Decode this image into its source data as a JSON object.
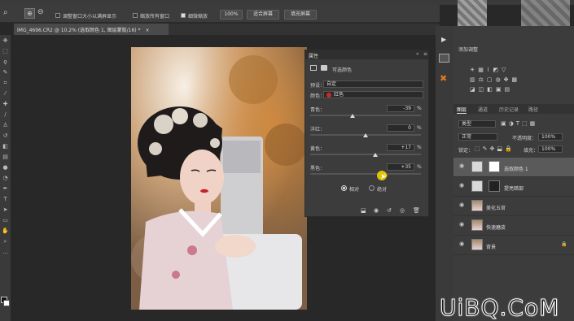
{
  "options_bar": {
    "checkbox1": "调整窗口大小以满屏显示",
    "checkbox2": "缩放所有窗口",
    "checkbox3": "细微缩放",
    "zoom_value": "100%",
    "fit_screen": "适合屏幕",
    "fill_screen": "填充屏幕"
  },
  "document_tab": {
    "title": "IMG_4696.CR2 @ 10.2% (选取颜色 1, 图层蒙版/16) *",
    "close": "×"
  },
  "properties": {
    "title": "属性",
    "panel_name": "可选颜色",
    "preset_label": "预设：",
    "preset_value": "自定",
    "color_label": "颜色：",
    "color_value": "红色",
    "sliders": [
      {
        "label": "青色：",
        "value": "-39",
        "unit": "%",
        "level": 0.38
      },
      {
        "label": "洋红：",
        "value": "0",
        "unit": "%",
        "level": 0.5
      },
      {
        "label": "黄色：",
        "value": "+17",
        "unit": "%",
        "level": 0.585
      },
      {
        "label": "黑色：",
        "value": "+35",
        "unit": "%",
        "level": 0.675
      }
    ],
    "relative": "相对",
    "absolute": "绝对"
  },
  "adjustments": {
    "title": "添加调整"
  },
  "layers_tabs": [
    "图层",
    "通道",
    "历史记录",
    "路径"
  ],
  "layers": {
    "filter_kind": "类型",
    "blend_mode": "正常",
    "opacity_label": "不透明度：",
    "opacity_value": "100%",
    "lock_label": "锁定：",
    "fill_label": "填充：",
    "fill_value": "100%",
    "items": [
      {
        "name": "选取颜色 1"
      },
      {
        "name": "提亮暗部"
      },
      {
        "name": "美化五官"
      },
      {
        "name": "快速磨皮"
      },
      {
        "name": "背景"
      }
    ]
  },
  "watermark": "UiBQ.CoM",
  "colors": {
    "selected_layer": "#5a5a5a",
    "red_swatch": "#c62a2a",
    "cursor": "#f0d000"
  }
}
